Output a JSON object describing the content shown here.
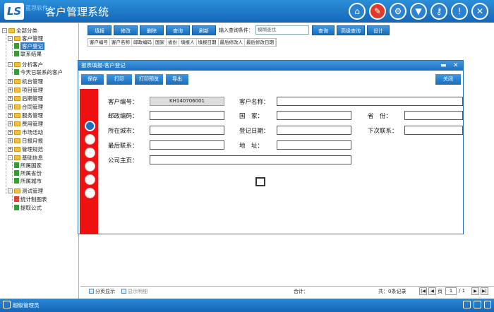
{
  "header": {
    "logo_text": "LS",
    "logo_sub": "蓝思软件",
    "title": "客户管理系统",
    "icons": [
      "home-icon",
      "report-icon",
      "gear-icon",
      "shirt-icon",
      "key-icon",
      "alert-icon",
      "close-icon"
    ]
  },
  "sidebar": {
    "root": "全部分类",
    "customer_mgmt": "客户管理",
    "customer_reg": "客户登记",
    "contact_result": "联系结果",
    "analysis": "分析客户",
    "uncontacted_today": "今天已联系的客户",
    "machine_mgmt": "机台管理",
    "project_mgmt": "项目管理",
    "after_sales": "后期管理",
    "contract_mgmt": "合同管理",
    "service_mgmt": "服务管理",
    "fee_mgmt": "费用管理",
    "market": "市场活动",
    "daily_report": "日报月报",
    "rules": "管理规范",
    "basic_info": "基础信息",
    "country": "所属国家",
    "province": "所属省份",
    "city": "所属城市",
    "test_mgmt": "测试管理",
    "chart_test": "统计制图表",
    "formula": "提取公式"
  },
  "toolbar": {
    "buttons": [
      "填报",
      "修改",
      "删除",
      "查询",
      "刷新"
    ],
    "query_label": "输入查询条件：",
    "query_placeholder": "模糊查找",
    "query_btn": "查询",
    "advanced_btn": "高级查询",
    "settings_btn": "设计"
  },
  "columns": [
    "客户编号",
    "客户名称",
    "邮政编码",
    "国家",
    "省份",
    "填报人",
    "填报日期",
    "最后修改人",
    "最后修改日期"
  ],
  "dialog": {
    "title": "报表填报-客户登记",
    "buttons": [
      "保存",
      "打印",
      "打印预览",
      "导出"
    ],
    "close_btn": "关闭",
    "fields": {
      "customer_no_label": "客户编号：",
      "customer_no_value": "KH140706001",
      "customer_name_label": "客户名称：",
      "postal_label": "邮政编码：",
      "country_label": "国　家：",
      "province_label": "省　份：",
      "city_label": "所在城市：",
      "reg_date_label": "登记日期：",
      "next_contact_label": "下次联系：",
      "last_contact_label": "最后联系：",
      "address_label": "地　址：",
      "business_label": "公司主页："
    }
  },
  "status": {
    "paging": "分页显示",
    "show_detail": "显示明细",
    "total": "合计：",
    "records": "共：0条记录",
    "page_label": "页",
    "page_no": "1",
    "page_total": "/ 1"
  },
  "footer": {
    "user": "超级管理员"
  }
}
